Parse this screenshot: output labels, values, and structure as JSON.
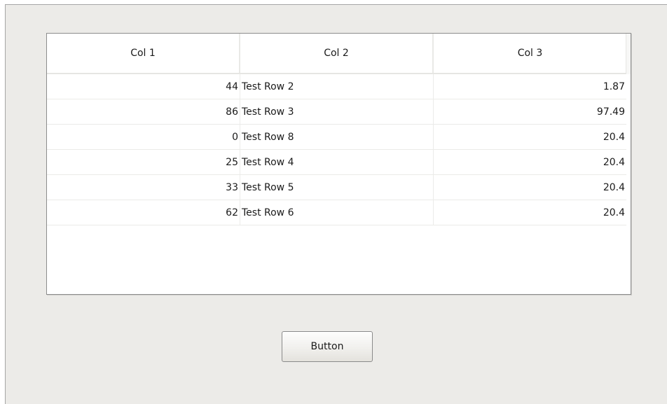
{
  "table": {
    "columns": [
      "Col 1",
      "Col 2",
      "Col 3"
    ],
    "rows": [
      [
        "44",
        "Test Row 2",
        "1.87"
      ],
      [
        "86",
        "Test Row 3",
        "97.49"
      ],
      [
        "0",
        "Test Row 8",
        "20.4"
      ],
      [
        "25",
        "Test Row 4",
        "20.4"
      ],
      [
        "33",
        "Test Row 5",
        "20.4"
      ],
      [
        "62",
        "Test Row 6",
        "20.4"
      ]
    ]
  },
  "button": {
    "label": "Button"
  }
}
